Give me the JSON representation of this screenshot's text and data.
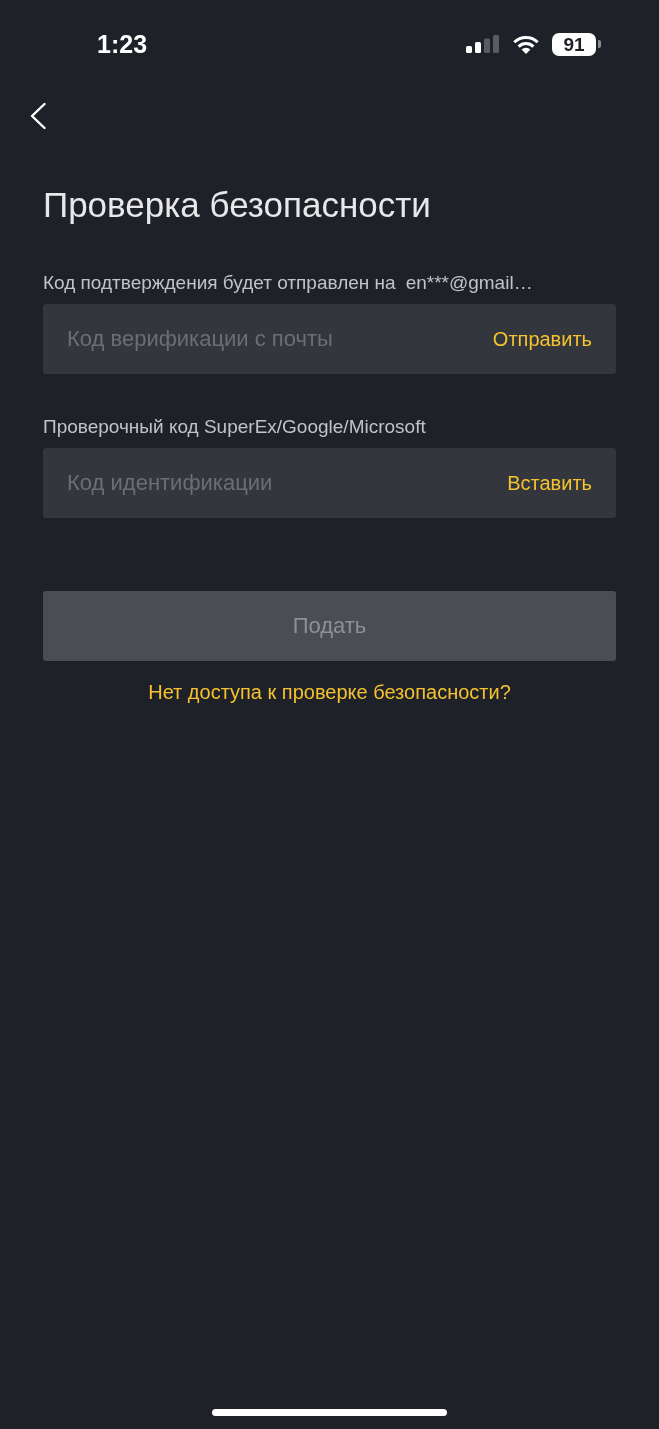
{
  "status_bar": {
    "time": "1:23",
    "battery": "91"
  },
  "title": "Проверка безопасности",
  "fields": [
    {
      "label": "Код подтверждения будет отправлен на",
      "email": "en***@gmail…",
      "placeholder": "Код верификации с почты",
      "action": "Отправить"
    },
    {
      "label": "Проверочный код SuperEx/Google/Microsoft",
      "placeholder": "Код идентификации",
      "action": "Вставить"
    }
  ],
  "submit": {
    "label": "Подать",
    "disabled": true
  },
  "help_link": "Нет доступа к проверке безопасности?"
}
